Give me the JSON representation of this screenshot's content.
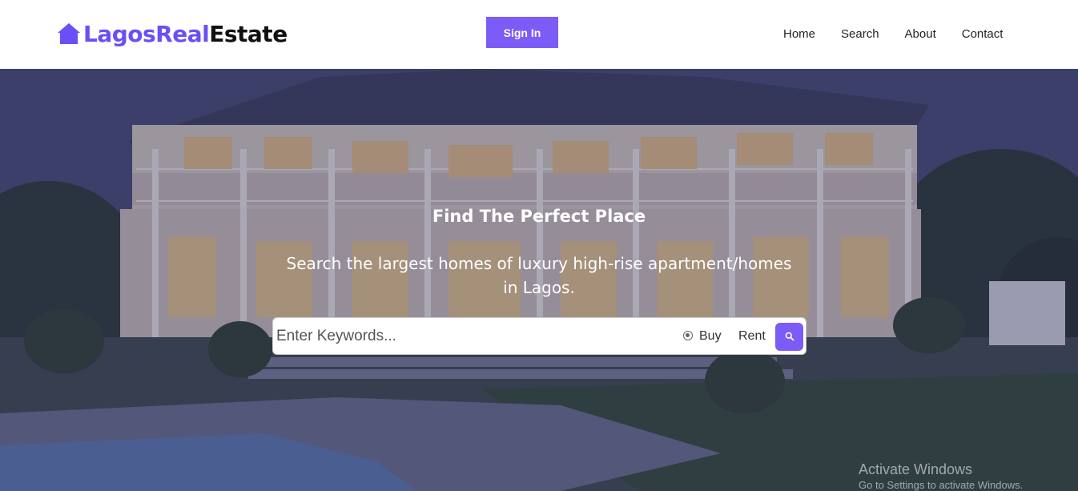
{
  "header": {
    "logo_part1": "LagosReal",
    "logo_part2": "Estate",
    "logo_icon": "home-icon",
    "signin_label": "Sign In",
    "nav": [
      {
        "label": "Home"
      },
      {
        "label": "Search"
      },
      {
        "label": "About"
      },
      {
        "label": "Contact"
      }
    ]
  },
  "hero": {
    "title": "Find The Perfect Place",
    "subtitle": "Search the largest homes of luxury high-rise apartment/homes in Lagos.",
    "search": {
      "placeholder": "Enter Keywords...",
      "value": "",
      "option_buy": "Buy",
      "option_rent": "Rent",
      "selected": "Buy",
      "button_icon": "search-icon"
    }
  },
  "watermark": {
    "line1": "Activate Windows",
    "line2": "Go to Settings to activate Windows."
  },
  "colors": {
    "accent": "#7b5cf7",
    "logo_purple": "#6a4ff7"
  }
}
